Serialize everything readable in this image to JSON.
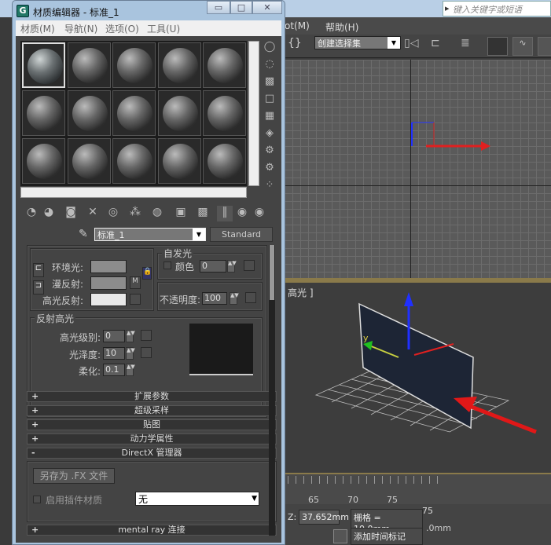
{
  "max_app": {
    "search_placeholder": "键入关键字或短语",
    "menu": [
      "ot(M)",
      "帮助(H)"
    ],
    "selection_set": "创建选择集",
    "viewport_label": "高光 ]",
    "ruler_ticks": [
      "65",
      "70",
      "75"
    ],
    "z_label": "Z:",
    "z_value": "37.652mm",
    "grid_label": "栅格 = 10.0mm",
    "add_time_tag": "添加时间标记",
    "partial_texts": [
      "75",
      "5",
      ".0mm",
      "5"
    ],
    "colors": {
      "viewport_bg": "#5a5a5a",
      "ui_bg": "#444444",
      "accent_gold": "#8a7a4a",
      "arrow_red": "#e02020"
    }
  },
  "material_editor": {
    "title": "材质编辑器 - 标准_1",
    "logo_letter": "G",
    "window_buttons": [
      "minimize",
      "maximize",
      "close"
    ],
    "menu": [
      "材质(M)",
      "导航(N)",
      "选项(O)",
      "工具(U)"
    ],
    "slots_selected": 0,
    "material_name": "标准_1",
    "material_type": "Standard",
    "basic": {
      "ambient": "环境光:",
      "diffuse": "漫反射:",
      "specular": "高光反射:",
      "map_button": "M",
      "self_illum_title": "自发光",
      "self_illum_color": "颜色",
      "self_illum_value": "0",
      "opacity_label": "不透明度:",
      "opacity_value": "100"
    },
    "specular_highlights": {
      "title": "反射高光",
      "level_label": "高光级别:",
      "level_value": "0",
      "gloss_label": "光泽度:",
      "gloss_value": "10",
      "soften_label": "柔化:",
      "soften_value": "0.1"
    },
    "rollouts": [
      {
        "sign": "+",
        "label": "扩展参数"
      },
      {
        "sign": "+",
        "label": "超级采样"
      },
      {
        "sign": "+",
        "label": "贴图"
      },
      {
        "sign": "+",
        "label": "动力学属性"
      },
      {
        "sign": "-",
        "label": "DirectX 管理器"
      }
    ],
    "directx": {
      "save_fx": "另存为 .FX 文件",
      "enable_plugin": "启用插件材质",
      "plugin_value": "无"
    },
    "last_rollout": {
      "sign": "+",
      "label": "mental ray 连接"
    }
  }
}
